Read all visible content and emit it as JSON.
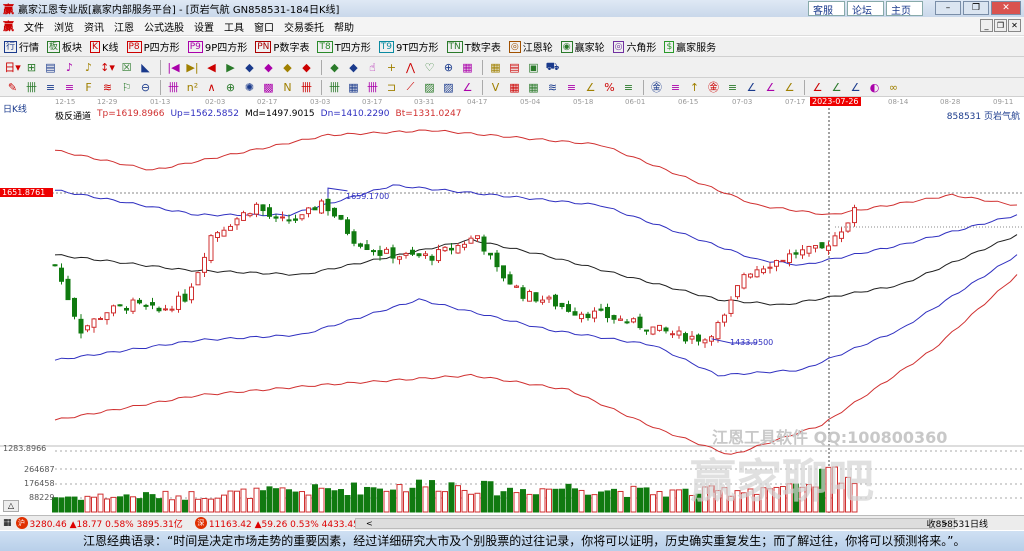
{
  "window": {
    "title": "赢家江恩专业版[赢家内部服务平台] - [页岩气航  GN858531-184日K线]",
    "links": [
      "客服",
      "论坛",
      "主页"
    ],
    "controls": [
      "–",
      "❐",
      "✕"
    ]
  },
  "menu": [
    "文件",
    "浏览",
    "资讯",
    "江恩",
    "公式选股",
    "设置",
    "工具",
    "窗口",
    "交易委托",
    "帮助"
  ],
  "toolbar1": [
    {
      "icon": "行",
      "label": "行情",
      "color": "#1a3a8c"
    },
    {
      "icon": "板",
      "label": "板块",
      "color": "#2a7a2a"
    },
    {
      "icon": "K",
      "label": "K线",
      "color": "#c00"
    },
    {
      "icon": "P8",
      "label": "P四方形",
      "color": "#c00"
    },
    {
      "icon": "P9",
      "label": "9P四方形",
      "color": "#a0a"
    },
    {
      "icon": "PN",
      "label": "P数字表",
      "color": "#a00"
    },
    {
      "icon": "T8",
      "label": "T四方形",
      "color": "#2a8a2a"
    },
    {
      "icon": "T9",
      "label": "9T四方形",
      "color": "#0a8aa0"
    },
    {
      "icon": "TN",
      "label": "T数字表",
      "color": "#2a7a2a"
    },
    {
      "icon": "◎",
      "label": "江恩轮",
      "color": "#a05000"
    },
    {
      "icon": "◉",
      "label": "赢家轮",
      "color": "#2a7a2a"
    },
    {
      "icon": "◎",
      "label": "六角形",
      "color": "#7030a0"
    },
    {
      "icon": "$",
      "label": "赢家服务",
      "color": "#2a9a2a"
    }
  ],
  "toolbar2": [
    "日▾",
    "⊞",
    "▤",
    "♪",
    "♪",
    "↕▾",
    "☒",
    "◣",
    "|◀",
    "▶|",
    "◀",
    "▶",
    "◆",
    "◆",
    "◆",
    "◆",
    "◆",
    "◆",
    "☝",
    "+",
    "⋀",
    "♡",
    "⊕",
    "▦",
    "▦",
    "▤",
    "▣",
    "⛟"
  ],
  "toolbar3": [
    "✎",
    "卌",
    "≡",
    "≡",
    "F",
    "≋",
    "⚐",
    "⊖",
    "卌",
    "n²",
    "∧",
    "⊕",
    "✺",
    "▩",
    "N",
    "卌",
    "卌",
    "▦",
    "卌",
    "⊐",
    "⟋",
    "▨",
    "▨",
    "∠",
    "V",
    "▦",
    "▦",
    "≋",
    "≡",
    "∠",
    "%",
    "≡",
    "㊎",
    "≡",
    "↑",
    "㊎",
    "≡",
    "∠",
    "∠",
    "∠",
    "∠",
    "∠",
    "∠",
    "◐",
    "∞"
  ],
  "date_axis": [
    "12-15",
    "12-29",
    "01-13",
    "02-03",
    "02-17",
    "03-03",
    "03-17",
    "03-31",
    "04-17",
    "05-04",
    "05-18",
    "06-01",
    "06-15",
    "07-03",
    "07-17",
    "2023-07-26",
    "08-14",
    "08-28",
    "09-11"
  ],
  "chart_tag": "日K线",
  "indicator": {
    "name": "极反通道",
    "tp": "Tp=1619.8966",
    "up": "Up=1562.5852",
    "md": "Md=1497.9015",
    "dn": "Dn=1410.2290",
    "bt": "Bt=1331.0247"
  },
  "stock_label": "858531 页岩气航",
  "price_marker": "1651.8761",
  "high_label": "1659.1700",
  "low_label": "1433.9500",
  "bottom_label": "1283.8966",
  "volume_labels": [
    "264687",
    "176458",
    "88229"
  ],
  "watermark": {
    "line1": "江恩工具软件  QQ:100800360",
    "line2": "赢家聊吧"
  },
  "chart_data": {
    "type": "candlestick",
    "bars": 124,
    "price_range": [
      1270,
      1760
    ],
    "close_keypoints": [
      [
        0,
        1547
      ],
      [
        4,
        1453
      ],
      [
        8,
        1480
      ],
      [
        12,
        1490
      ],
      [
        16,
        1480
      ],
      [
        20,
        1500
      ],
      [
        22,
        1540
      ],
      [
        24,
        1590
      ],
      [
        28,
        1615
      ],
      [
        31,
        1634
      ],
      [
        34,
        1610
      ],
      [
        38,
        1615
      ],
      [
        41,
        1640
      ],
      [
        43,
        1620
      ],
      [
        46,
        1585
      ],
      [
        50,
        1565
      ],
      [
        54,
        1560
      ],
      [
        58,
        1560
      ],
      [
        62,
        1575
      ],
      [
        65,
        1590
      ],
      [
        68,
        1540
      ],
      [
        72,
        1505
      ],
      [
        76,
        1495
      ],
      [
        80,
        1480
      ],
      [
        84,
        1475
      ],
      [
        88,
        1465
      ],
      [
        92,
        1455
      ],
      [
        96,
        1445
      ],
      [
        100,
        1440
      ],
      [
        103,
        1470
      ],
      [
        106,
        1535
      ],
      [
        110,
        1550
      ],
      [
        114,
        1565
      ],
      [
        118,
        1570
      ],
      [
        121,
        1600
      ],
      [
        123,
        1625
      ]
    ],
    "bands": [
      {
        "name": "Tp",
        "color": "#d03030",
        "points": [
          [
            0,
            1714
          ],
          [
            15,
            1685
          ],
          [
            42,
            1736
          ],
          [
            58,
            1743
          ],
          [
            84,
            1722
          ],
          [
            108,
            1634
          ],
          [
            119,
            1620
          ],
          [
            138,
            1649
          ],
          [
            148,
            1634
          ]
        ]
      },
      {
        "name": "Up",
        "color": "#3030c0",
        "points": [
          [
            0,
            1656
          ],
          [
            22,
            1620
          ],
          [
            36,
            1620
          ],
          [
            52,
            1663
          ],
          [
            84,
            1634
          ],
          [
            108,
            1555
          ],
          [
            115,
            1547
          ],
          [
            130,
            1576
          ],
          [
            148,
            1620
          ]
        ]
      },
      {
        "name": "Md",
        "color": "#202020",
        "points": [
          [
            0,
            1562
          ],
          [
            20,
            1540
          ],
          [
            38,
            1533
          ],
          [
            53,
            1562
          ],
          [
            64,
            1584
          ],
          [
            75,
            1562
          ],
          [
            102,
            1497
          ],
          [
            112,
            1489
          ],
          [
            130,
            1518
          ],
          [
            148,
            1591
          ]
        ]
      },
      {
        "name": "Dn",
        "color": "#3030c0",
        "points": [
          [
            0,
            1409
          ],
          [
            22,
            1438
          ],
          [
            38,
            1446
          ],
          [
            56,
            1497
          ],
          [
            76,
            1453
          ],
          [
            92,
            1431
          ],
          [
            102,
            1387
          ],
          [
            115,
            1395
          ],
          [
            130,
            1453
          ],
          [
            148,
            1562
          ]
        ]
      },
      {
        "name": "Bt",
        "color": "#d03030",
        "points": [
          [
            0,
            1322
          ],
          [
            22,
            1358
          ],
          [
            41,
            1373
          ],
          [
            64,
            1387
          ],
          [
            79,
            1366
          ],
          [
            93,
            1308
          ],
          [
            104,
            1271
          ],
          [
            118,
            1315
          ],
          [
            135,
            1424
          ],
          [
            148,
            1533
          ]
        ]
      }
    ],
    "volume_max": 300000,
    "volume_keypoints": [
      [
        0,
        90000
      ],
      [
        20,
        100000
      ],
      [
        40,
        130000
      ],
      [
        50,
        150000
      ],
      [
        60,
        170000
      ],
      [
        70,
        130000
      ],
      [
        80,
        150000
      ],
      [
        90,
        120000
      ],
      [
        100,
        120000
      ],
      [
        110,
        150000
      ],
      [
        116,
        130000
      ],
      [
        118,
        220000
      ],
      [
        121,
        250000
      ],
      [
        123,
        190000
      ]
    ]
  },
  "status": {
    "sh": "3280.46 ▲18.77 0.58% 3895.31亿",
    "sz": "11163.42 ▲59.26 0.53% 4433.45亿",
    "sh_icon": "沪",
    "sz_icon": "深",
    "right": "收858531日线"
  },
  "quote": "江恩经典语录：“时间是决定市场走势的重要因素，经过详细研究大市及个别股票的过往记录，你将可以证明，历史确实重复发生；而了解过往，你将可以预测将来。”。"
}
